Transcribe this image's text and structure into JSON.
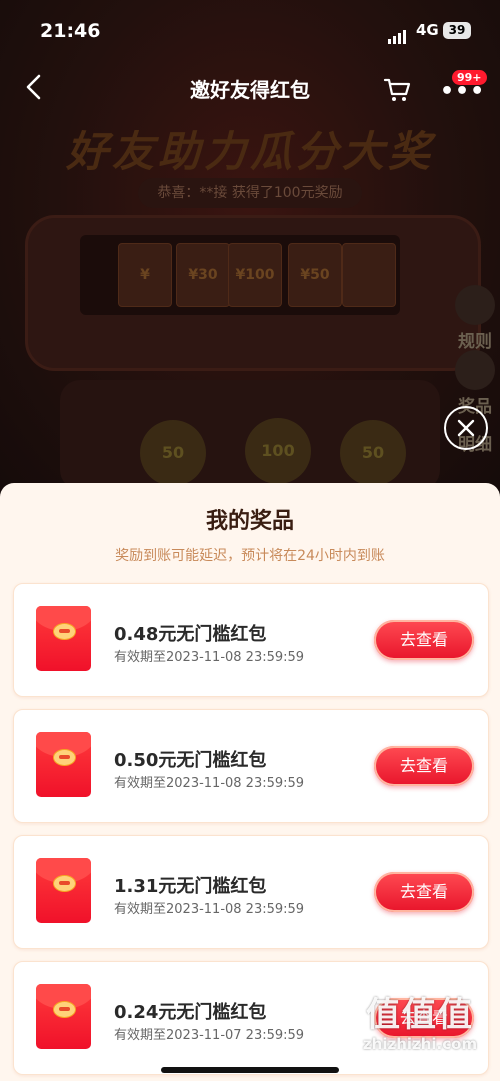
{
  "status_bar": {
    "time": "21:46",
    "network": "4G",
    "battery": "39"
  },
  "nav": {
    "title": "邀好友得红包",
    "badge": "99+"
  },
  "background": {
    "headline": "好友助力瓜分大奖",
    "congrats": "恭喜：**接 获得了100元奖励",
    "cards": [
      "¥",
      "¥30",
      "¥100",
      "¥50",
      ""
    ],
    "balls": [
      "50",
      "100",
      "50"
    ],
    "side_buttons": [
      "规则",
      "奖品",
      "明细"
    ]
  },
  "sheet": {
    "title": "我的奖品",
    "subtitle": "奖励到账可能延迟，预计将在24小时内到账",
    "prizes": [
      {
        "name": "0.48元无门槛红包",
        "expire": "有效期至2023-11-08 23:59:59",
        "button": "去查看"
      },
      {
        "name": "0.50元无门槛红包",
        "expire": "有效期至2023-11-08 23:59:59",
        "button": "去查看"
      },
      {
        "name": "1.31元无门槛红包",
        "expire": "有效期至2023-11-08 23:59:59",
        "button": "去查看"
      },
      {
        "name": "0.24元无门槛红包",
        "expire": "有效期至2023-11-07 23:59:59",
        "button": "去查看"
      }
    ]
  },
  "watermark": {
    "logo": "值值值",
    "site": "zhizhizhi.com"
  }
}
